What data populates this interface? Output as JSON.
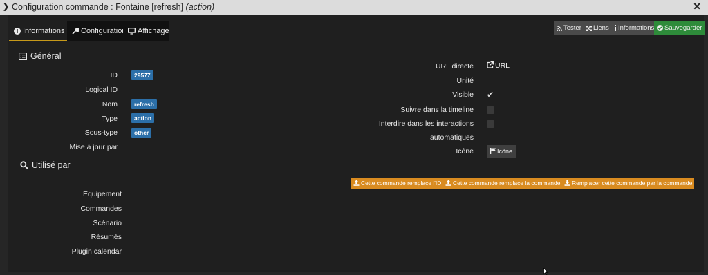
{
  "window": {
    "title_prefix": "Configuration commande : Fontaine [refresh]",
    "title_italic": "(action)"
  },
  "tabs": [
    {
      "label": "Informations",
      "icon": "info-circle-icon",
      "active": true
    },
    {
      "label": "Configuration",
      "icon": "wrench-icon",
      "active": false
    },
    {
      "label": "Affichage",
      "icon": "monitor-icon",
      "active": false
    }
  ],
  "toolbar": {
    "tester": "Tester",
    "liens": "Liens",
    "informations": "Informations",
    "sauvegarder": "Sauvegarder"
  },
  "general": {
    "heading": "Général",
    "id_label": "ID",
    "id_value": "29577",
    "logical_id_label": "Logical ID",
    "nom_label": "Nom",
    "nom_value": "refresh",
    "type_label": "Type",
    "type_value": "action",
    "soustype_label": "Sous-type",
    "soustype_value": "other",
    "maj_label": "Mise à jour par"
  },
  "utilise": {
    "heading": "Utilisé par",
    "items": [
      "Equipement",
      "Commandes",
      "Scénario",
      "Résumés",
      "Plugin calendar"
    ]
  },
  "right": {
    "url_label": "URL directe",
    "url_value": "URL",
    "unite_label": "Unité",
    "visible_label": "Visible",
    "visible_checked": true,
    "timeline_label": "Suivre dans la timeline",
    "interdire_label_1": "Interdire dans les interactions",
    "interdire_label_2": "automatiques",
    "icone_label": "Icône",
    "icone_button": "Icône"
  },
  "actions": {
    "remplace_id": "Cette commande remplace l'ID",
    "remplace_cmd": "Cette commande remplace la commande",
    "remplacer_par": "Remplacer cette commande par la commande"
  },
  "colors": {
    "badge": "#2c6fa8",
    "save": "#2e8b3a",
    "orange": "#d98b20",
    "tab_underline": "#c79a1a"
  }
}
